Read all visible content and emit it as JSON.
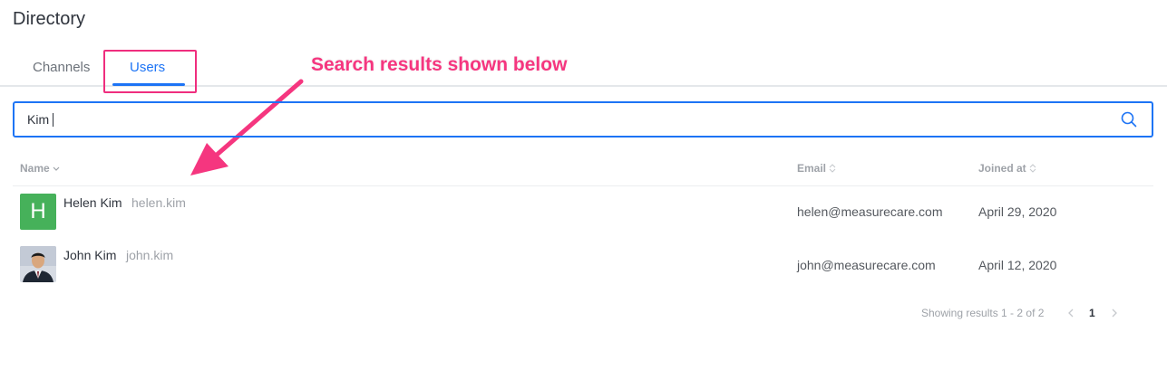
{
  "page": {
    "title": "Directory"
  },
  "tabs": [
    {
      "label": "Channels",
      "active": false
    },
    {
      "label": "Users",
      "active": true
    }
  ],
  "annotation": {
    "text": "Search results shown below",
    "color": "#f5367f"
  },
  "search": {
    "value": "Kim",
    "icon": "search-icon"
  },
  "table": {
    "columns": [
      {
        "label": "Name",
        "sort_icon": "sort-down-icon"
      },
      {
        "label": "Email",
        "sort_icon": "sort-icon"
      },
      {
        "label": "Joined at",
        "sort_icon": "sort-icon"
      }
    ],
    "rows": [
      {
        "name": "Helen Kim",
        "username": "helen.kim",
        "email": "helen@measurecare.com",
        "joined": "April 29, 2020",
        "avatar_letter": "H",
        "avatar_color": "#46b15a"
      },
      {
        "name": "John Kim",
        "username": "john.kim",
        "email": "john@measurecare.com",
        "joined": "April 12, 2020",
        "avatar": "user-photo"
      }
    ]
  },
  "pagination": {
    "summary": "Showing results 1 - 2 of 2",
    "current_page": "1"
  },
  "colors": {
    "accent": "#1d74f5",
    "highlight": "#ef2e7e"
  }
}
